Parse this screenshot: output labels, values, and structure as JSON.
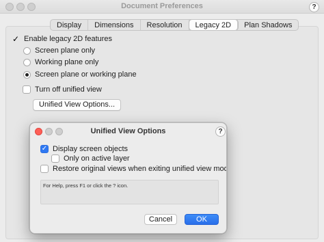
{
  "window": {
    "title": "Document Preferences",
    "help_label": "?"
  },
  "tabs": [
    {
      "label": "Display",
      "active": false
    },
    {
      "label": "Dimensions",
      "active": false
    },
    {
      "label": "Resolution",
      "active": false
    },
    {
      "label": "Legacy 2D",
      "active": true
    },
    {
      "label": "Plan Shadows",
      "active": false
    }
  ],
  "legacy2d": {
    "enable_label": "Enable legacy 2D features",
    "enable_checked": true,
    "radio_options": [
      {
        "label": "Screen plane only",
        "selected": false
      },
      {
        "label": "Working plane only",
        "selected": false
      },
      {
        "label": "Screen plane or working plane",
        "selected": true
      }
    ],
    "turn_off_label": "Turn off unified view",
    "turn_off_checked": false,
    "unified_button_label": "Unified View Options..."
  },
  "dialog": {
    "title": "Unified View Options",
    "help_label": "?",
    "display_screen_objects_label": "Display screen objects",
    "display_screen_objects_checked": true,
    "only_active_layer_label": "Only on active layer",
    "only_active_layer_checked": false,
    "restore_views_label": "Restore original views when exiting unified view mode",
    "restore_views_checked": false,
    "help_text": "For Help, press F1 or click the ? icon.",
    "cancel_label": "Cancel",
    "ok_label": "OK"
  },
  "colors": {
    "accent": "#2f78f2",
    "background": "#ececec"
  }
}
